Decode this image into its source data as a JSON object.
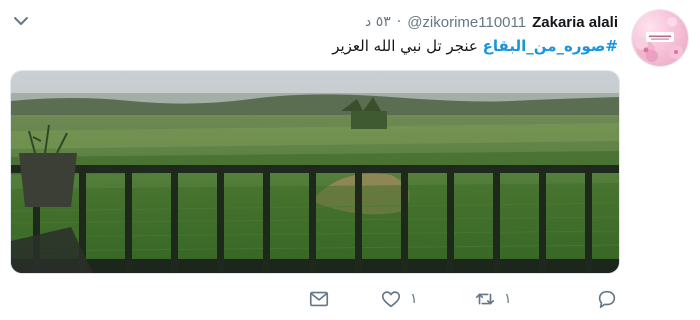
{
  "tweet": {
    "author_name": "Zakaria alali",
    "author_handle": "@zikorime110011",
    "separator": "·",
    "timestamp": "٥٣ د",
    "hashtag": "#صوره_من_البقاع",
    "text": "عنجر تل نبي الله العزير",
    "avatar_icon": "flower-avatar",
    "colors": {
      "hashtag": "#1b95e0",
      "secondary": "#657786",
      "primary_text": "#14171a"
    }
  },
  "actions": {
    "reply_icon": "reply-icon",
    "retweet_icon": "retweet-icon",
    "retweet_count": "١",
    "like_icon": "heart-icon",
    "like_count": "١",
    "dm_icon": "envelope-icon"
  }
}
